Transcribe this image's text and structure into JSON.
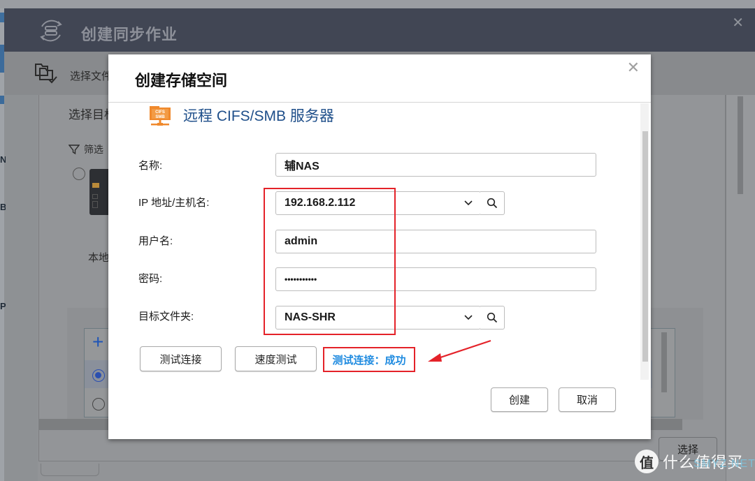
{
  "outer_window": {
    "title": "创建同步作业",
    "toolbar_label": "选择文件",
    "panel_title": "选择目标",
    "filter_label": "筛选",
    "local_label": "本地",
    "select_button": "选择",
    "list_add_symbol": "+"
  },
  "modal": {
    "title": "创建存储空间",
    "server_type": "远程 CIFS/SMB 服务器",
    "server_icon_text": [
      "CIFS",
      "SMB"
    ],
    "fields": {
      "name": {
        "label": "名称:",
        "value": "辅NAS"
      },
      "host": {
        "label": "IP 地址/主机名:",
        "value": "192.168.2.112"
      },
      "username": {
        "label": "用户名:",
        "value": "admin"
      },
      "password": {
        "label": "密码:",
        "value": "•••••••••••"
      },
      "target_folder": {
        "label": "目标文件夹:",
        "value": "NAS-SHR"
      }
    },
    "buttons": {
      "test_connection": "测试连接",
      "speed_test": "速度测试",
      "create": "创建",
      "cancel": "取消"
    },
    "status": "测试连接：成功",
    "colors": {
      "annotation_red": "#e42229",
      "status_blue": "#1f8be0",
      "server_title_blue": "#1f4f8a",
      "icon_orange": "#f0892c"
    }
  },
  "watermark": {
    "badge": "值",
    "text": "什么值得买",
    "overlay": "SMYZ.NET"
  }
}
